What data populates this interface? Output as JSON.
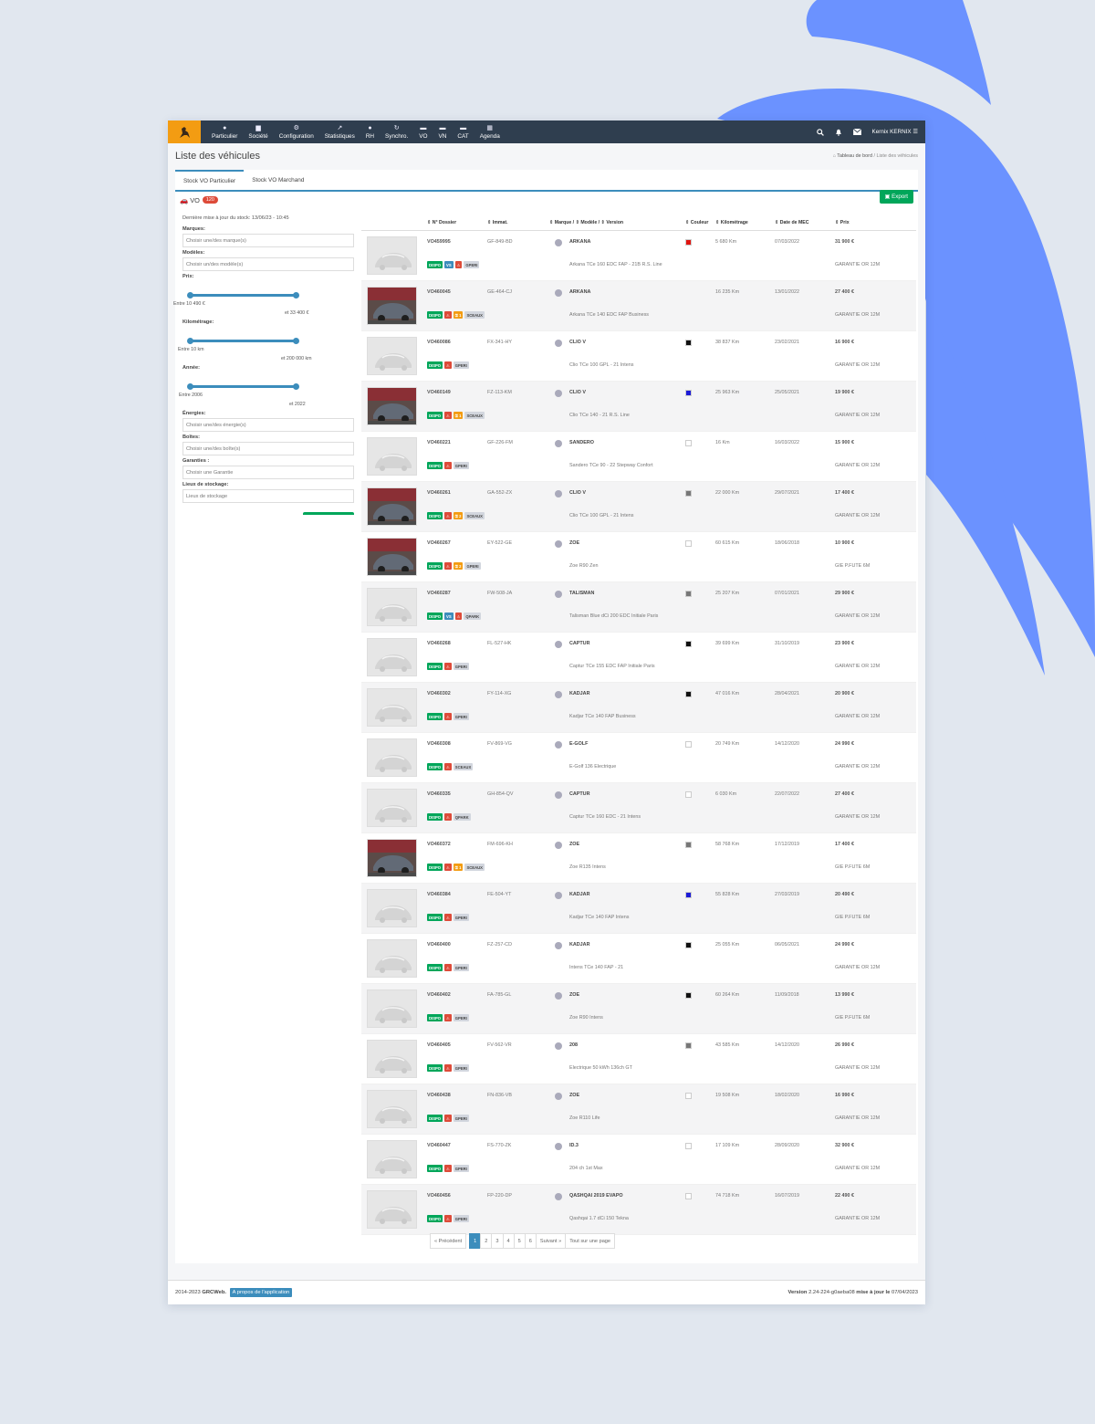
{
  "nav": [
    "Particulier",
    "Société",
    "Configuration",
    "Statistiques",
    "RH",
    "Synchro.",
    "VO",
    "VN",
    "CAT",
    "Agenda"
  ],
  "user": "Kernix KERNIX",
  "page_title": "Liste des véhicules",
  "breadcrumb": {
    "home": "Tableau de bord",
    "current": "Liste des véhicules"
  },
  "tabs": [
    "Stock VO Particulier",
    "Stock VO Marchand"
  ],
  "box": {
    "label": "VO",
    "count": "120",
    "export": "Export"
  },
  "filters": {
    "update_text": "Dernière mise à jour du stock: 13/06/23 - 10:45",
    "marques_label": "Marques:",
    "marques_ph": "Choisir une/des marque(s)",
    "modeles_label": "Modèles:",
    "modeles_ph": "Choisir un/des modèle(s)",
    "prix_label": "Prix:",
    "prix_from": "Entre 10 490 €",
    "prix_to": "et 33 400 €",
    "km_label": "Kilométrage:",
    "km_from": "Entre 10 km",
    "km_to": "et 200 000 km",
    "annee_label": "Année:",
    "annee_from": "Entre 2006",
    "annee_to": "et 2022",
    "energies_label": "Énergies:",
    "energies_ph": "Choisir une/des énergie(s)",
    "boites_label": "Boîtes:",
    "boites_ph": "Choisir une/des boîte(s)",
    "garanties_label": "Garanties :",
    "garanties_ph": "Choisir une Garantie",
    "lieux_label": "Lieux de stockage:",
    "lieux_ph": "Lieux de stockage"
  },
  "columns": {
    "dossier": "N° Dossier",
    "immat": "Immat.",
    "marque": "Marque / ⇕ Modèle / ⇕ Version",
    "couleur": "Couleur",
    "km": "Kilométrage",
    "mec": "Date de MEC",
    "prix": "Prix"
  },
  "rows": [
    {
      "d": "VO459995",
      "i": "GF-849-BD",
      "m": "ARKANA",
      "v": "Arkana TCe 160 EDC FAP - 21B R.S. Line",
      "c": "#e0140f",
      "k": "5 680 Km",
      "t": "07/03/2022",
      "p": "31 900 €",
      "g": "GARANTIE OR 12M",
      "b": [
        [
          "DISPO",
          "dispo"
        ],
        [
          "VS",
          "vs"
        ],
        [
          "⚠",
          "warn"
        ],
        [
          "GPERI",
          "grey"
        ]
      ],
      "photo": false
    },
    {
      "d": "VO460045",
      "i": "GE-464-CJ",
      "m": "ARKANA",
      "v": "Arkana TCe 140 EDC FAP Business",
      "c": "",
      "k": "16 235 Km",
      "t": "13/01/2022",
      "p": "27 400 €",
      "g": "GARANTIE OR 12M",
      "b": [
        [
          "DISPO",
          "dispo"
        ],
        [
          "⚠",
          "warn"
        ],
        [
          "⚿ 1",
          "key"
        ],
        [
          "SCEAUX",
          "grey"
        ]
      ],
      "photo": true
    },
    {
      "d": "VO460086",
      "i": "FX-341-HY",
      "m": "CLIO V",
      "v": "Clio TCe 100 GPL - 21 Intens",
      "c": "#111111",
      "k": "38 837 Km",
      "t": "23/02/2021",
      "p": "16 900 €",
      "g": "GARANTIE OR 12M",
      "b": [
        [
          "DISPO",
          "dispo"
        ],
        [
          "⚠",
          "warn"
        ],
        [
          "GPERI",
          "grey"
        ]
      ],
      "photo": false
    },
    {
      "d": "VO460149",
      "i": "FZ-113-KM",
      "m": "CLIO V",
      "v": "Clio TCe 140 - 21 R.S. Line",
      "c": "#1c1ad6",
      "k": "25 963 Km",
      "t": "25/05/2021",
      "p": "19 900 €",
      "g": "GARANTIE OR 12M",
      "b": [
        [
          "DISPO",
          "dispo"
        ],
        [
          "⚠",
          "warn"
        ],
        [
          "⚿ 1",
          "key"
        ],
        [
          "SCEAUX",
          "grey"
        ]
      ],
      "photo": true
    },
    {
      "d": "VO460221",
      "i": "GF-226-FM",
      "m": "SANDERO",
      "v": "Sandero TCe 90 - 22 Stepway Confort",
      "c": "#ffffff",
      "k": "16 Km",
      "t": "16/03/2022",
      "p": "15 900 €",
      "g": "GARANTIE OR 12M",
      "b": [
        [
          "DISPO",
          "dispo"
        ],
        [
          "⚠",
          "warn"
        ],
        [
          "GPERI",
          "grey"
        ]
      ],
      "photo": false
    },
    {
      "d": "VO460261",
      "i": "GA-552-ZX",
      "m": "CLIO V",
      "v": "Clio TCe 100 GPL - 21 Intens",
      "c": "#777777",
      "k": "22 000 Km",
      "t": "29/07/2021",
      "p": "17 400 €",
      "g": "GARANTIE OR 12M",
      "b": [
        [
          "DISPO",
          "dispo"
        ],
        [
          "⚠",
          "warn"
        ],
        [
          "⚿ 2",
          "key"
        ],
        [
          "SCEAUX",
          "grey"
        ]
      ],
      "photo": true
    },
    {
      "d": "VO460267",
      "i": "EY-522-GE",
      "m": "ZOE",
      "v": "Zoe R90 Zen",
      "c": "#ffffff",
      "k": "60 615 Km",
      "t": "18/06/2018",
      "p": "10 900 €",
      "g": "GIE P.FUTE 6M",
      "b": [
        [
          "DISPO",
          "dispo"
        ],
        [
          "⚠",
          "warn"
        ],
        [
          "⚿ 2",
          "key"
        ],
        [
          "GPERI",
          "grey"
        ]
      ],
      "photo": true
    },
    {
      "d": "VO460287",
      "i": "FW-508-JA",
      "m": "TALISMAN",
      "v": "Talisman Blue dCi 200 EDC Initiale Paris",
      "c": "#777777",
      "k": "25 207 Km",
      "t": "07/01/2021",
      "p": "29 900 €",
      "g": "GARANTIE OR 12M",
      "b": [
        [
          "DISPO",
          "dispo"
        ],
        [
          "VS",
          "vs"
        ],
        [
          "⚠",
          "warn"
        ],
        [
          "QPARK",
          "grey"
        ]
      ],
      "photo": false
    },
    {
      "d": "VO460268",
      "i": "FL-527-HK",
      "m": "CAPTUR",
      "v": "Captur TCe 155 EDC FAP Initiale Paris",
      "c": "#111111",
      "k": "39 699 Km",
      "t": "31/10/2019",
      "p": "23 900 €",
      "g": "GARANTIE OR 12M",
      "b": [
        [
          "DISPO",
          "dispo"
        ],
        [
          "⚠",
          "warn"
        ],
        [
          "GPERI",
          "grey"
        ]
      ],
      "photo": false
    },
    {
      "d": "VO460302",
      "i": "FY-114-XG",
      "m": "KADJAR",
      "v": "Kadjar TCe 140 FAP Business",
      "c": "#111111",
      "k": "47 016 Km",
      "t": "28/04/2021",
      "p": "20 900 €",
      "g": "GARANTIE OR 12M",
      "b": [
        [
          "DISPO",
          "dispo"
        ],
        [
          "⚠",
          "warn"
        ],
        [
          "GPERI",
          "grey"
        ]
      ],
      "photo": false
    },
    {
      "d": "VO460308",
      "i": "FV-869-VG",
      "m": "E-GOLF",
      "v": "E-Golf 136 Electrique",
      "c": "#ffffff",
      "k": "20 749 Km",
      "t": "14/12/2020",
      "p": "24 990 €",
      "g": "GARANTIE OR 12M",
      "b": [
        [
          "DISPO",
          "dispo"
        ],
        [
          "⚠",
          "warn"
        ],
        [
          "SCEAUX",
          "grey"
        ]
      ],
      "photo": false
    },
    {
      "d": "VO460335",
      "i": "GH-854-QV",
      "m": "CAPTUR",
      "v": "Captur TCe 160 EDC - 21 Intens",
      "c": "#ffffff",
      "k": "6 030 Km",
      "t": "22/07/2022",
      "p": "27 400 €",
      "g": "GARANTIE OR 12M",
      "b": [
        [
          "DISPO",
          "dispo"
        ],
        [
          "⚠",
          "warn"
        ],
        [
          "QPARK",
          "grey"
        ]
      ],
      "photo": false
    },
    {
      "d": "VO460372",
      "i": "FM-696-KH",
      "m": "ZOE",
      "v": "Zoe R135 Intens",
      "c": "#777777",
      "k": "58 768 Km",
      "t": "17/12/2019",
      "p": "17 400 €",
      "g": "GIE P.FUTE 6M",
      "b": [
        [
          "DISPO",
          "dispo"
        ],
        [
          "⚠",
          "warn"
        ],
        [
          "⚿ 1",
          "key"
        ],
        [
          "SCEAUX",
          "grey"
        ]
      ],
      "photo": true
    },
    {
      "d": "VO460384",
      "i": "FE-504-YT",
      "m": "KADJAR",
      "v": "Kadjar TCe 140 FAP Intens",
      "c": "#1c1ad6",
      "k": "55 828 Km",
      "t": "27/03/2019",
      "p": "20 490 €",
      "g": "GIE P.FUTE 6M",
      "b": [
        [
          "DISPO",
          "dispo"
        ],
        [
          "⚠",
          "warn"
        ],
        [
          "GPERI",
          "grey"
        ]
      ],
      "photo": false
    },
    {
      "d": "VO460400",
      "i": "FZ-257-CD",
      "m": "KADJAR",
      "v": "Intens TCe 140 FAP - 21",
      "c": "#111111",
      "k": "25 055 Km",
      "t": "06/05/2021",
      "p": "24 990 €",
      "g": "GARANTIE OR 12M",
      "b": [
        [
          "DISPO",
          "dispo"
        ],
        [
          "⚠",
          "warn"
        ],
        [
          "GPERI",
          "grey"
        ]
      ],
      "photo": false
    },
    {
      "d": "VO460402",
      "i": "FA-785-GL",
      "m": "ZOE",
      "v": "Zoe R90 Intens",
      "c": "#111111",
      "k": "60 264 Km",
      "t": "11/09/2018",
      "p": "13 990 €",
      "g": "GIE P.FUTE 6M",
      "b": [
        [
          "DISPO",
          "dispo"
        ],
        [
          "⚠",
          "warn"
        ],
        [
          "GPERI",
          "grey"
        ]
      ],
      "photo": false
    },
    {
      "d": "VO460405",
      "i": "FV-562-VR",
      "m": "208",
      "v": "Electrique 50 kWh 136ch GT",
      "c": "#777777",
      "k": "43 585 Km",
      "t": "14/12/2020",
      "p": "26 990 €",
      "g": "GARANTIE OR 12M",
      "b": [
        [
          "DISPO",
          "dispo"
        ],
        [
          "⚠",
          "warn"
        ],
        [
          "GPERI",
          "grey"
        ]
      ],
      "photo": false
    },
    {
      "d": "VO460438",
      "i": "FN-836-VB",
      "m": "ZOE",
      "v": "Zoe R110 Life",
      "c": "#ffffff",
      "k": "19 508 Km",
      "t": "18/02/2020",
      "p": "16 990 €",
      "g": "GARANTIE OR 12M",
      "b": [
        [
          "DISPO",
          "dispo"
        ],
        [
          "⚠",
          "warn"
        ],
        [
          "GPERI",
          "grey"
        ]
      ],
      "photo": false
    },
    {
      "d": "VO460447",
      "i": "FS-770-ZK",
      "m": "ID.3",
      "v": "204 ch 1st Max",
      "c": "#ffffff",
      "k": "17 109 Km",
      "t": "28/09/2020",
      "p": "32 900 €",
      "g": "GARANTIE OR 12M",
      "b": [
        [
          "DISPO",
          "dispo"
        ],
        [
          "⚠",
          "warn"
        ],
        [
          "GPERI",
          "grey"
        ]
      ],
      "photo": false
    },
    {
      "d": "VO460456",
      "i": "FP-220-DP",
      "m": "QASHQAI 2019 EVAPO",
      "v": "Qashqai 1.7 dCi 150 Tekna",
      "c": "#ffffff",
      "k": "74 718 Km",
      "t": "16/07/2019",
      "p": "22 490 €",
      "g": "GARANTIE OR 12M",
      "b": [
        [
          "DISPO",
          "dispo"
        ],
        [
          "⚠",
          "warn"
        ],
        [
          "GPERI",
          "grey"
        ]
      ],
      "photo": false
    }
  ],
  "pagination": {
    "prev": "« Précédent",
    "pages": [
      "1",
      "2",
      "3",
      "4",
      "5",
      "6"
    ],
    "next": "Suivant »",
    "all": "Tout sur une page",
    "current": "1"
  },
  "footer": {
    "copy": "2014-2023",
    "brand": "GRCWeb.",
    "about": "A propos de l'application",
    "version_label": "Version",
    "version": "2.24-224-g0aeba08",
    "updated_label": "mise à jour le",
    "updated": "07/04/2023"
  }
}
